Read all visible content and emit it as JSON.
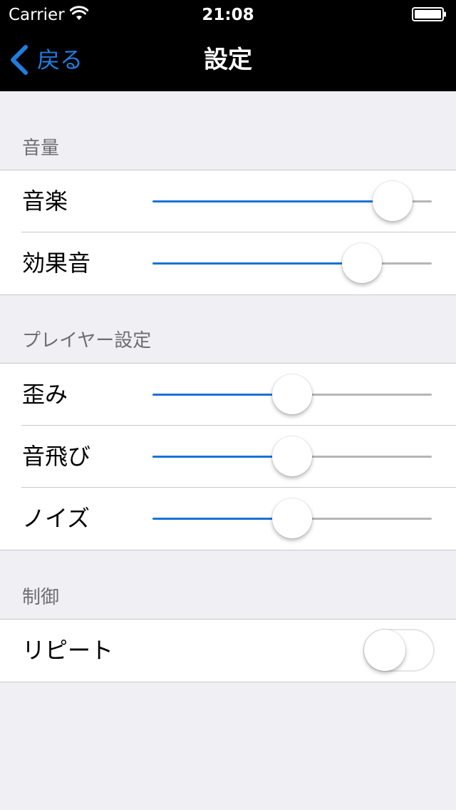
{
  "status_bar": {
    "carrier": "Carrier",
    "time": "21:08",
    "wifi_icon": "wifi-icon",
    "battery_icon": "battery-icon"
  },
  "nav": {
    "back_label": "戻る",
    "back_icon": "chevron-left-icon",
    "title": "設定"
  },
  "colors": {
    "accent": "#1a73d6",
    "back_text": "#1f7de0",
    "background": "#efeff4",
    "header_text": "#6d6d72"
  },
  "sections": {
    "volume": {
      "header": "音量",
      "rows": [
        {
          "label": "音楽",
          "value": 0.86
        },
        {
          "label": "効果音",
          "value": 0.75
        }
      ]
    },
    "player": {
      "header": "プレイヤー設定",
      "rows": [
        {
          "label": "歪み",
          "value": 0.5
        },
        {
          "label": "音飛び",
          "value": 0.5
        },
        {
          "label": "ノイズ",
          "value": 0.5
        }
      ]
    },
    "control": {
      "header": "制御",
      "rows": [
        {
          "label": "リピート",
          "on": false
        }
      ]
    }
  }
}
